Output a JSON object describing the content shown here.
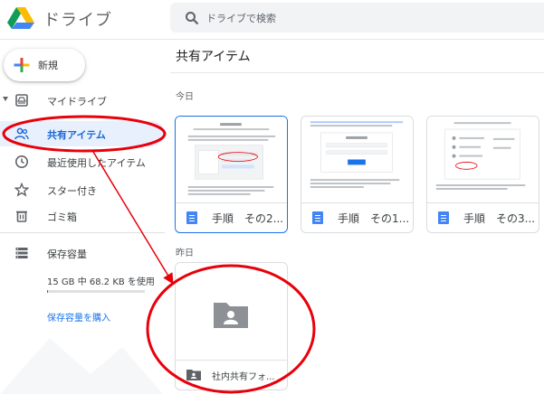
{
  "header": {
    "app_title": "ドライブ",
    "search_placeholder": "ドライブで検索"
  },
  "sidebar": {
    "new_label": "新規",
    "items": [
      {
        "label": "マイドライブ",
        "icon": "my-drive-icon"
      },
      {
        "label": "共有アイテム",
        "icon": "shared-people-icon",
        "active": true
      },
      {
        "label": "最近使用したアイテム",
        "icon": "clock-icon"
      },
      {
        "label": "スター付き",
        "icon": "star-icon"
      },
      {
        "label": "ゴミ箱",
        "icon": "trash-icon"
      }
    ],
    "storage": {
      "label": "保存容量",
      "usage_text": "15 GB 中 68.2 KB を使用",
      "used_fraction": 0.01,
      "buy_label": "保存容量を購入"
    }
  },
  "main": {
    "title": "共有アイテム",
    "sections": [
      {
        "label": "今日",
        "files": [
          {
            "name": "手順　その2...",
            "type": "google-doc",
            "selected": true
          },
          {
            "name": "手順　その1...",
            "type": "google-doc"
          },
          {
            "name": "手順　その3...",
            "type": "google-doc"
          }
        ]
      },
      {
        "label": "昨日",
        "folders": [
          {
            "name": "社内共有フォ...",
            "type": "shared-folder"
          }
        ]
      }
    ]
  },
  "annotation": {
    "color": "#e8000b"
  },
  "colors": {
    "accent_blue": "#1a73e8",
    "active_bg": "#e8f0fe",
    "doc_blue": "#4285f4"
  }
}
